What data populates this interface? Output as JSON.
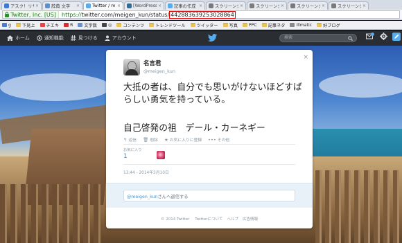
{
  "browser": {
    "tabs": [
      {
        "label": "アスク！リサイ",
        "color": "#3a7bd5"
      },
      {
        "label": "辞典 文字",
        "color": "#5a8fd8"
      },
      {
        "label": "Twitter / m",
        "color": "#55acee",
        "active": true
      },
      {
        "label": "[WordPress",
        "color": "#2a6f9e"
      },
      {
        "label": "記事の作成",
        "color": "#55acee"
      },
      {
        "label": "スクリーンショ",
        "color": "#7a7a7a"
      },
      {
        "label": "スクリーンショ",
        "color": "#7a7a7a"
      },
      {
        "label": "スクリーンショ",
        "color": "#7a7a7a"
      },
      {
        "label": "スクリーンショ",
        "color": "#7a7a7a"
      }
    ],
    "tab_close": "×",
    "cert_label": "Twitter, Inc. [US]",
    "url_scheme": "https://",
    "url_host_path": "twitter.com/meigen_kun/status/",
    "url_status_id": "442883639253028864",
    "bookmarks": [
      {
        "label": "g",
        "icon": "g-icon"
      },
      {
        "label": "下見上",
        "icon": "folder-icon"
      },
      {
        "label": "チエキ",
        "icon": "app-icon"
      },
      {
        "label": "R",
        "icon": "r-icon"
      },
      {
        "label": "文字数",
        "icon": "doc-icon"
      },
      {
        "label": "◎",
        "icon": "circle-icon"
      },
      {
        "label": "コンテンツ",
        "icon": "folder-icon"
      },
      {
        "label": "トレンドツール",
        "icon": "folder-icon"
      },
      {
        "label": "ツイッター",
        "icon": "folder-icon"
      },
      {
        "label": "写真",
        "icon": "folder-icon"
      },
      {
        "label": "PPC",
        "icon": "folder-icon"
      },
      {
        "label": "記事ネタ",
        "icon": "folder-icon"
      },
      {
        "label": "Illmatic",
        "icon": "illmatic-icon"
      },
      {
        "label": "好ブログ",
        "icon": "folder-icon"
      }
    ]
  },
  "twitter_nav": {
    "home": "ホーム",
    "notifications": "通知機能",
    "discover": "見つける",
    "account": "アカウント",
    "search_placeholder": "検索",
    "messages_badge": "3"
  },
  "tweet": {
    "close": "×",
    "name": "名言君",
    "screen_name": "@meigen_kun",
    "text": "大抵の者は、自分でも思いがけないほどすばらしい勇気を持っている。",
    "text_line2": "自己啓発の祖　デール・カーネギー",
    "actions": [
      {
        "icon": "reply-icon",
        "glyph": "↰",
        "label": "返信"
      },
      {
        "icon": "delete-icon",
        "glyph": "🗑",
        "label": "削除"
      },
      {
        "icon": "favorite-icon",
        "glyph": "★",
        "label": "お気に入りに登録"
      },
      {
        "icon": "more-icon",
        "glyph": "•••",
        "label": "その他"
      }
    ],
    "stat_label": "お気に入り",
    "stat_count": "1",
    "timestamp": "13:44 - 2014年3月10日",
    "reply_mention": "@meigen_kun",
    "reply_suffix": "さんへ返信する"
  },
  "footer": {
    "copyright": "© 2014 Twitter",
    "links": [
      "Twitterについて",
      "ヘルプ",
      "広告情報"
    ]
  }
}
